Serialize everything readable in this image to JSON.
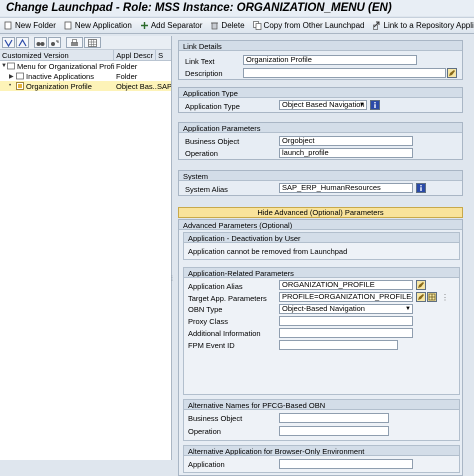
{
  "window": {
    "title": "Change Launchpad - Role: MSS Instance: ORGANIZATION_MENU (EN)"
  },
  "toolbar": {
    "new_folder": "New Folder",
    "new_application": "New Application",
    "add_separator": "Add Separator",
    "delete": "Delete",
    "copy_from_other": "Copy from Other Launchpad",
    "link_to_repository": "Link to a Repository Application"
  },
  "tree": {
    "columns": [
      "Customized Version",
      "Appl Descr",
      "S"
    ],
    "rows": [
      {
        "label": "Menu for Organizational Profile",
        "descr": "Folder",
        "s": ""
      },
      {
        "label": "Inactive Applications",
        "descr": "Folder",
        "s": ""
      },
      {
        "label": "Organization Profile",
        "descr": "Object Bas...",
        "s": "SAP"
      }
    ]
  },
  "link_details": {
    "header": "Link Details",
    "link_text_label": "Link Text",
    "link_text_value": "Organization Profile",
    "description_label": "Description",
    "description_value": ""
  },
  "application_type": {
    "header": "Application Type",
    "label": "Application Type",
    "value": "Object Based Navigation"
  },
  "application_parameters": {
    "header": "Application Parameters",
    "business_object_label": "Business Object",
    "business_object_value": "Orgobject",
    "operation_label": "Operation",
    "operation_value": "launch_profile"
  },
  "system": {
    "header": "System",
    "alias_label": "System Alias",
    "alias_value": "SAP_ERP_HumanResources"
  },
  "advanced": {
    "toggle_label": "Hide Advanced (Optional) Parameters",
    "header": "Advanced Parameters (Optional)",
    "deactivation_header": "Application - Deactivation by User",
    "deactivation_text": "Application cannot be removed from Launchpad",
    "related_header": "Application-Related Parameters",
    "alias_label": "Application Alias",
    "alias_value": "ORGANIZATION_PROFILE",
    "target_label": "Target App. Parameters",
    "target_value": "PROFILE=ORGANIZATION_PROFILE&SU...",
    "obn_type_label": "OBN Type",
    "obn_type_value": "Object-Based Navigation",
    "proxy_label": "Proxy Class",
    "proxy_value": "",
    "addinfo_label": "Additional Information",
    "addinfo_value": "",
    "fpm_label": "FPM Event ID",
    "fpm_value": "",
    "alt_names_header": "Alternative Names for PFCG-Based OBN",
    "alt_bo_label": "Business Object",
    "alt_bo_value": "",
    "alt_op_label": "Operation",
    "alt_op_value": "",
    "alt_app_header": "Alternative Application for Browser-Only Environment",
    "alt_app_label": "Application",
    "alt_app_value": ""
  }
}
